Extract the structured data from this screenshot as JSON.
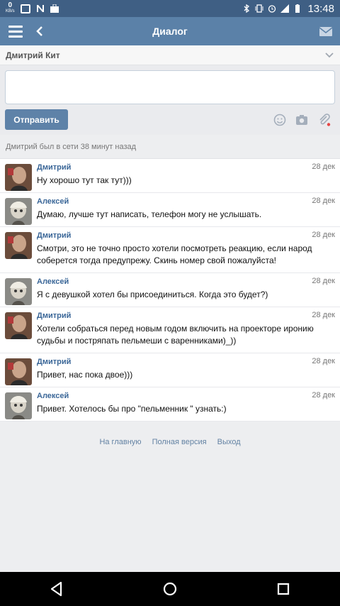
{
  "status_bar": {
    "speed": "0",
    "speed_unit": "KB/s",
    "time": "13:48"
  },
  "header": {
    "title": "Диалог"
  },
  "recipient": {
    "name": "Дмитрий Кит"
  },
  "compose": {
    "send_label": "Отправить",
    "value": ""
  },
  "online_status": "Дмитрий был в сети 38 минут назад",
  "messages": [
    {
      "author": "Дмитрий",
      "date": "28 дек",
      "text": "Ну хорошо тут так тут)))"
    },
    {
      "author": "Алексей",
      "date": "28 дек",
      "text": "Думаю, лучше тут написать, телефон могу не услышать."
    },
    {
      "author": "Дмитрий",
      "date": "28 дек",
      "text": "Смотри, это не точно просто хотели посмотреть реакцию, если народ соберется тогда предупрежу. Скинь номер свой пожалуйста!"
    },
    {
      "author": "Алексей",
      "date": "28 дек",
      "text": "Я с девушкой хотел бы присоединиться. Когда это будет?)"
    },
    {
      "author": "Дмитрий",
      "date": "28 дек",
      "text": "Хотели собраться перед новым годом включить на проекторе иронию судьбы и постряпать пельмеши с варенниками)_))"
    },
    {
      "author": "Дмитрий",
      "date": "28 дек",
      "text": "Привет, нас пока двое)))"
    },
    {
      "author": "Алексей",
      "date": "28 дек",
      "text": "Привет. Хотелось бы про \"пельменник \" узнать:)"
    }
  ],
  "footer": {
    "home": "На главную",
    "full_version": "Полная версия",
    "logout": "Выход"
  },
  "colors": {
    "header": "#5b81a8",
    "status_bar": "#3f5f84",
    "link": "#3b6798",
    "send_button": "#5e82a8"
  }
}
